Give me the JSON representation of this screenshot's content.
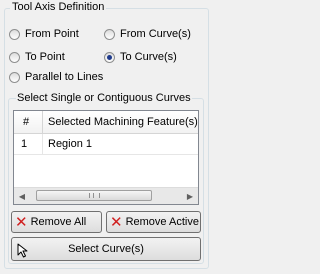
{
  "group": {
    "title": "Tool Axis Definition"
  },
  "radios": {
    "from_point": {
      "label": "From Point",
      "checked": false
    },
    "from_curves": {
      "label": "From Curve(s)",
      "checked": false
    },
    "to_point": {
      "label": "To Point",
      "checked": false
    },
    "to_curves": {
      "label": "To Curve(s)",
      "checked": true
    },
    "parallel": {
      "label": "Parallel to Lines",
      "checked": false
    }
  },
  "selection": {
    "title": "Select Single or Contiguous Curves",
    "columns": [
      "#",
      "Selected Machining Feature(s)"
    ],
    "rows": [
      {
        "num": "1",
        "feature": "Region 1"
      }
    ]
  },
  "buttons": {
    "remove_all": "Remove All",
    "remove_active": "Remove Active",
    "select_curves": "Select Curve(s)"
  },
  "icons": {
    "remove": "x-icon",
    "select": "arrow-cursor-icon"
  },
  "colors": {
    "remove_icon": "#d02020",
    "radio_selected": "#1f3b8c"
  }
}
